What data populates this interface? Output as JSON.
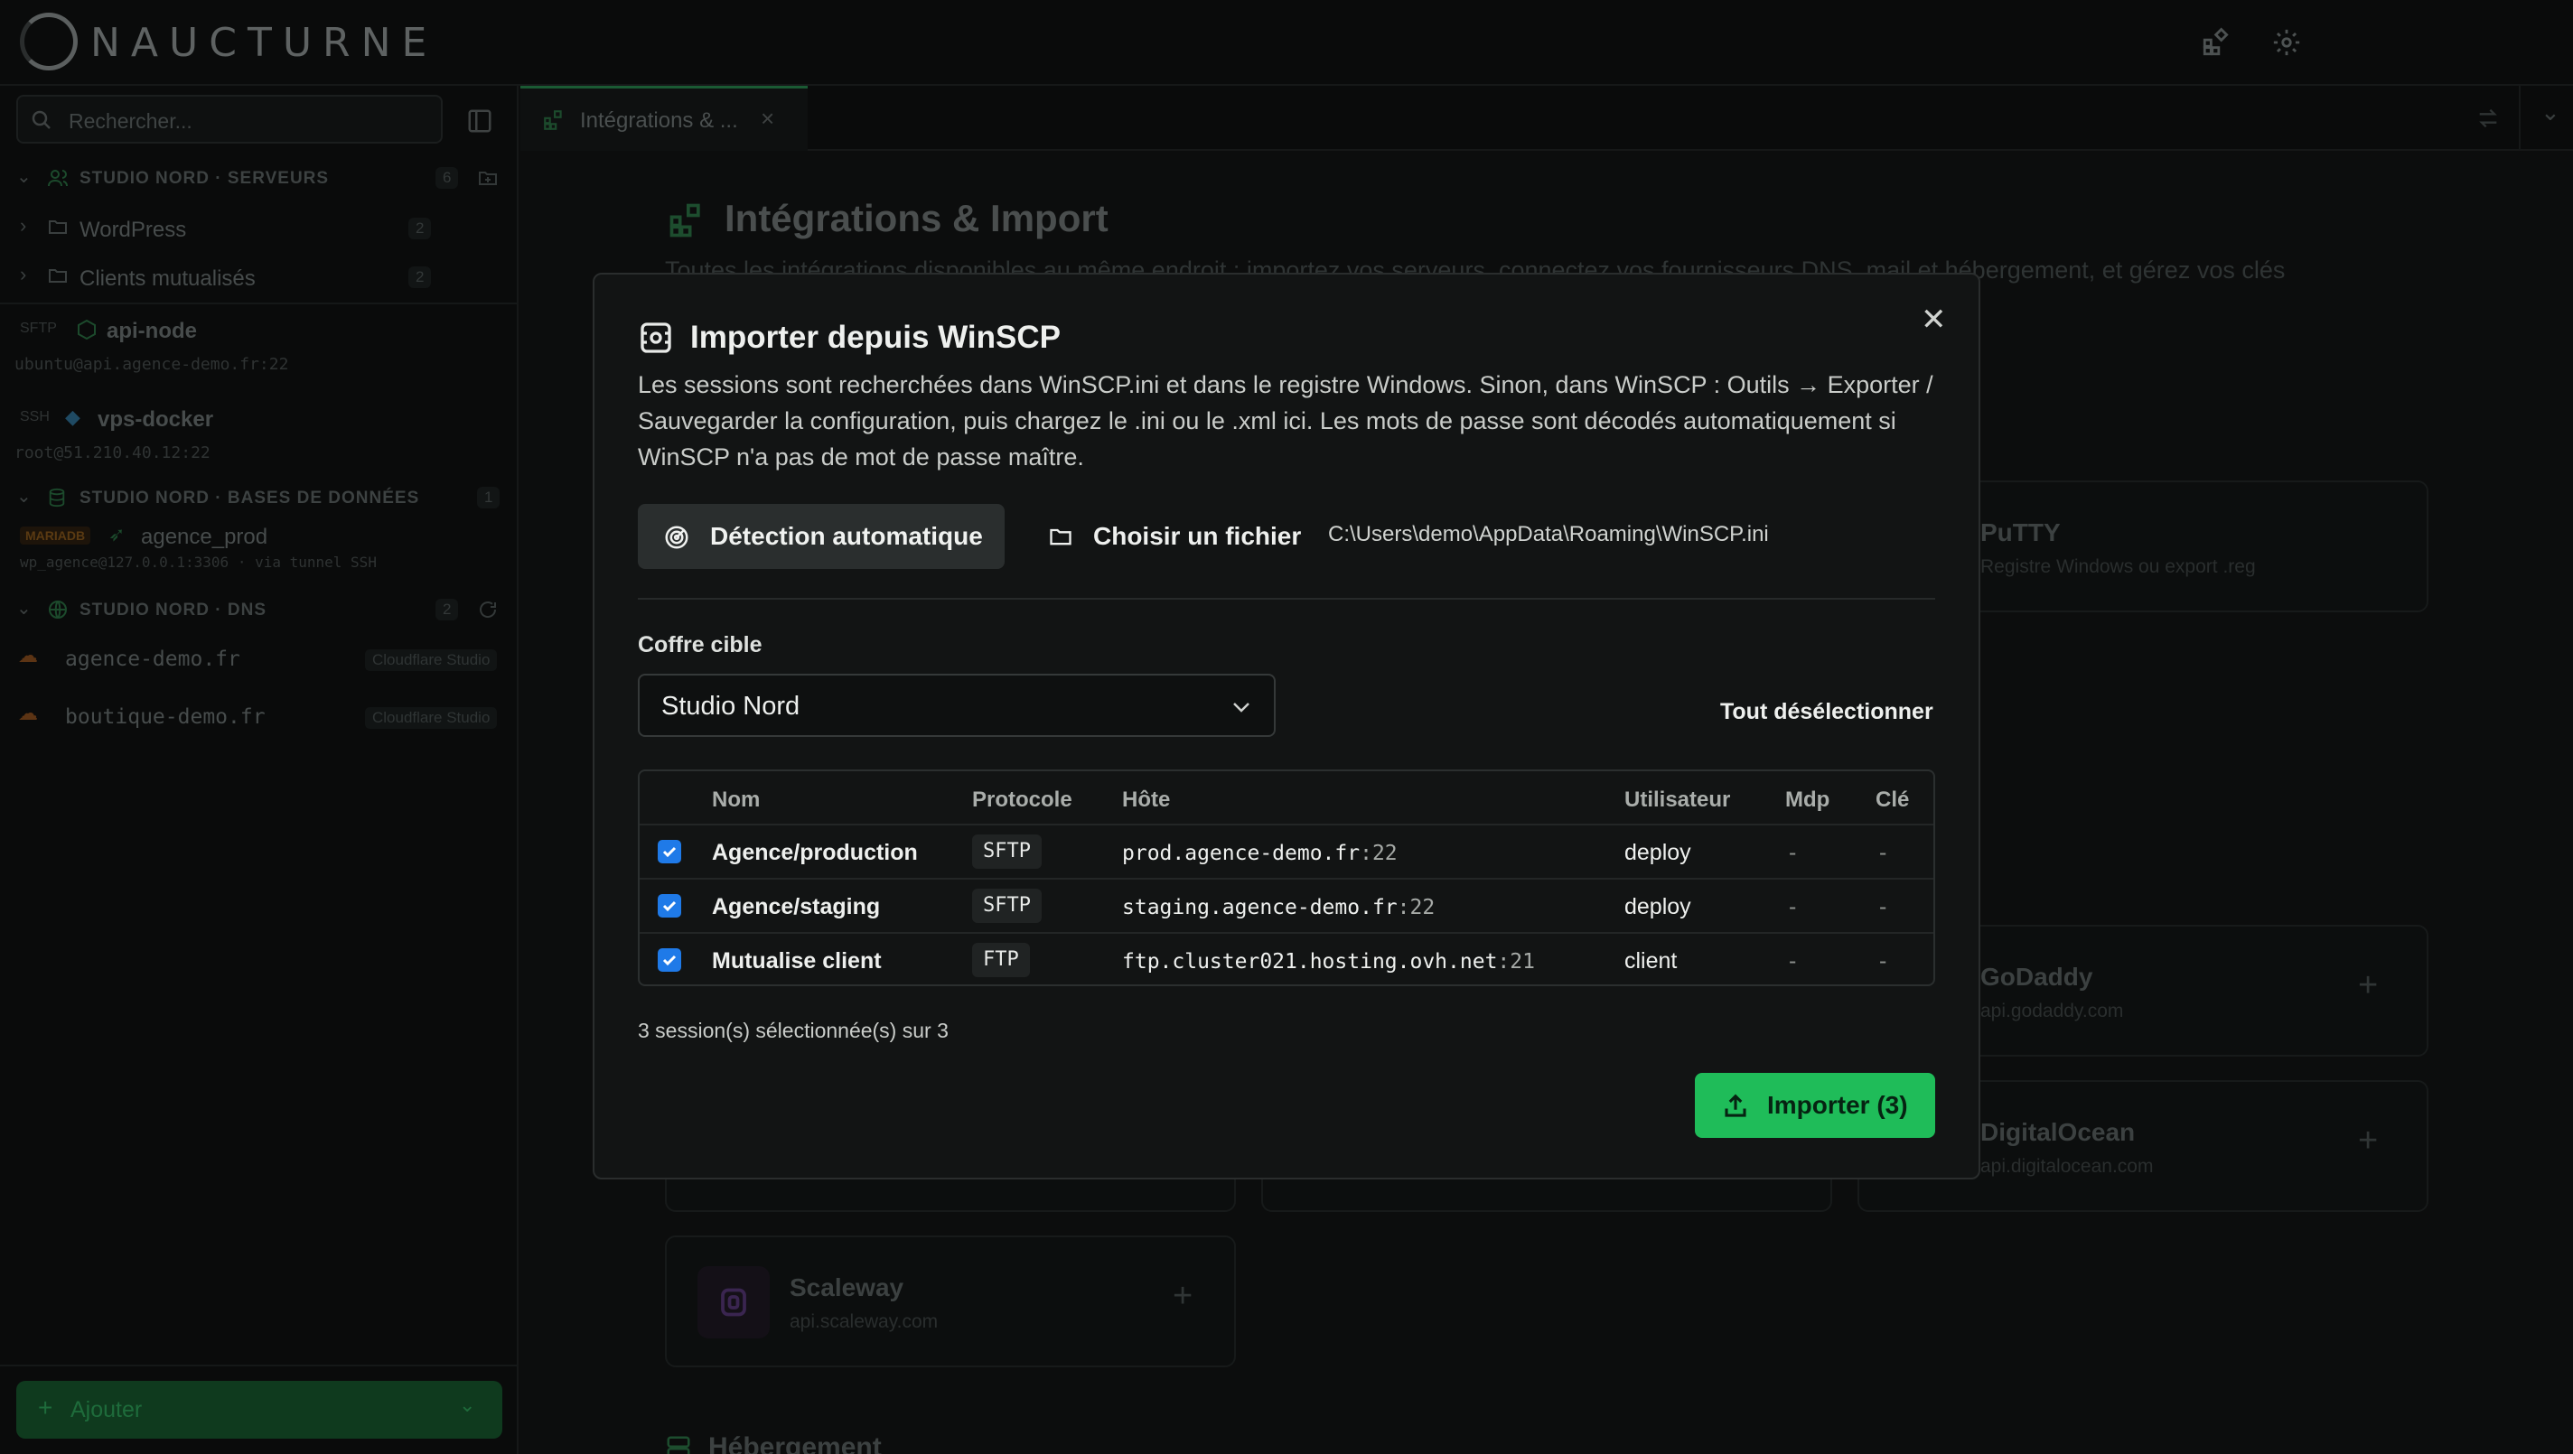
{
  "app": {
    "logo_text": "NAUCTURNE"
  },
  "sidebar": {
    "search_placeholder": "Rechercher...",
    "groups": [
      {
        "title": "STUDIO NORD · SERVEURS",
        "count": "6"
      },
      {
        "title": "STUDIO NORD · BASES DE DONNÉES",
        "count": "1"
      },
      {
        "title": "STUDIO NORD · DNS",
        "count": "2"
      }
    ],
    "folders": [
      {
        "label": "WordPress",
        "count": "2"
      },
      {
        "label": "Clients mutualisés",
        "count": "2"
      }
    ],
    "servers": [
      {
        "proto": "SFTP",
        "name": "api-node",
        "addr": "ubuntu@api.agence-demo.fr:22"
      },
      {
        "proto": "SSH",
        "name": "vps-docker",
        "addr": "root@51.210.40.12:22"
      }
    ],
    "database": {
      "engine": "MARIADB",
      "name": "agence_prod",
      "addr": "wp_agence@127.0.0.1:3306 · via tunnel SSH"
    },
    "dns": [
      {
        "domain": "agence-demo.fr",
        "provider": "Cloudflare Studio"
      },
      {
        "domain": "boutique-demo.fr",
        "provider": "Cloudflare Studio"
      }
    ],
    "add_label": "Ajouter"
  },
  "tab": {
    "label": "Intégrations & ..."
  },
  "page": {
    "title": "Intégrations & Import",
    "subtitle": "Toutes les intégrations disponibles au même endroit : importez vos serveurs, connectez vos fournisseurs DNS, mail et hébergement, et gérez vos clés",
    "section_label": "Hébergement",
    "cards": [
      {
        "name": "PuTTY",
        "sub": "Registre Windows ou export .reg"
      },
      {
        "name": "GoDaddy",
        "sub": "api.godaddy.com"
      },
      {
        "name": "DigitalOcean",
        "sub": "api.digitalocean.com"
      },
      {
        "name": "Scaleway",
        "sub": "api.scaleway.com"
      }
    ],
    "plus": "+"
  },
  "modal": {
    "title": "Importer depuis WinSCP",
    "close": "✕",
    "description": "Les sessions sont recherchées dans WinSCP.ini et dans le registre Windows. Sinon, dans WinSCP : Outils → Exporter / Sauvegarder la configuration, puis chargez le .ini ou le .xml ici. Les mots de passe sont décodés automatiquement si WinSCP n'a pas de mot de passe maître.",
    "auto_detect": "Détection automatique",
    "choose_file": "Choisir un fichier",
    "file_path": "C:\\Users\\demo\\AppData\\Roaming\\WinSCP.ini",
    "vault_label": "Coffre cible",
    "vault_value": "Studio Nord",
    "deselect_all": "Tout désélectionner",
    "columns": [
      "Nom",
      "Protocole",
      "Hôte",
      "Utilisateur",
      "Mdp",
      "Clé"
    ],
    "rows": [
      {
        "name": "Agence/production",
        "proto": "SFTP",
        "host": "prod.agence-demo.fr",
        "port": ":22",
        "user": "deploy",
        "pwd": "-",
        "key": "-",
        "checked": true
      },
      {
        "name": "Agence/staging",
        "proto": "SFTP",
        "host": "staging.agence-demo.fr",
        "port": ":22",
        "user": "deploy",
        "pwd": "-",
        "key": "-",
        "checked": true
      },
      {
        "name": "Mutualise client",
        "proto": "FTP",
        "host": "ftp.cluster021.hosting.ovh.net",
        "port": ":21",
        "user": "client",
        "pwd": "-",
        "key": "-",
        "checked": true
      }
    ],
    "summary": "3 session(s) sélectionnée(s) sur 3",
    "import_button": "Importer (3)"
  },
  "colors": {
    "accent": "#1fbc59",
    "checkbox": "#1f7ae8"
  }
}
